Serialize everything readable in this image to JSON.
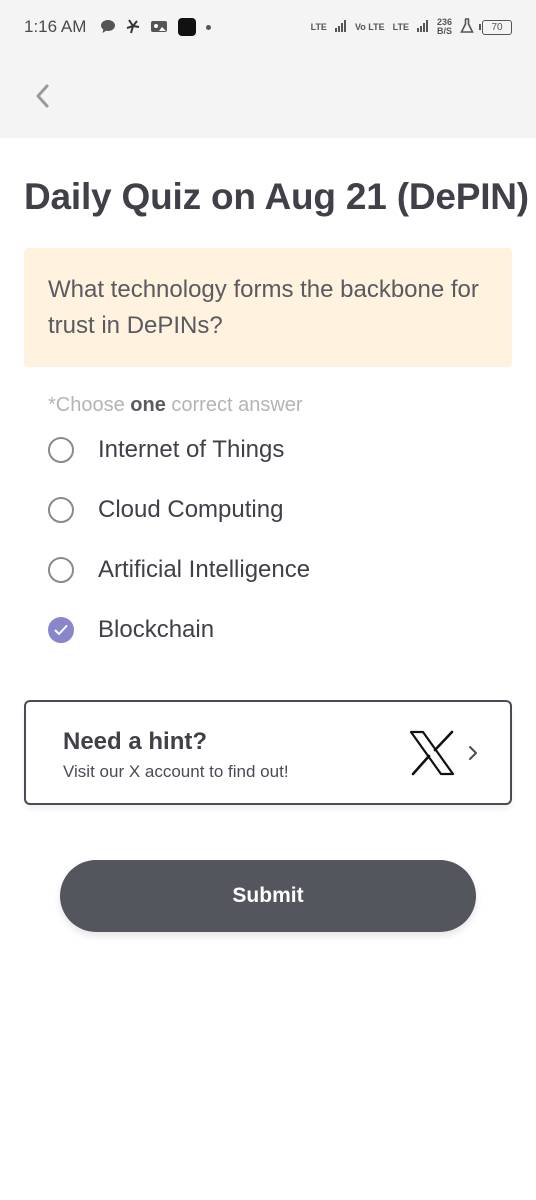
{
  "status_bar": {
    "time": "1:16 AM",
    "left_icons": [
      "chat-bubble-icon",
      "pinwheel-icon",
      "photo-icon",
      "app-square-icon",
      "dot-icon"
    ],
    "network_1": "LTE",
    "network_2": "Vo LTE",
    "network_3": "LTE",
    "speed_value": "236",
    "speed_unit": "B/S",
    "battery": "70"
  },
  "nav": {
    "back_icon": "chevron-left-icon"
  },
  "quiz": {
    "title": "Daily Quiz on Aug 21 (DePIN)",
    "question": "What technology forms the backbone for trust in DePINs?",
    "instruction_prefix": "*Choose ",
    "instruction_emphasis": "one",
    "instruction_suffix": " correct answer",
    "options": [
      {
        "label": "Internet of Things",
        "selected": false
      },
      {
        "label": "Cloud Computing",
        "selected": false
      },
      {
        "label": "Artificial Intelligence",
        "selected": false
      },
      {
        "label": "Blockchain",
        "selected": true
      }
    ]
  },
  "hint": {
    "title": "Need a hint?",
    "subtitle": "Visit our X account to find out!",
    "icon": "x-logo-icon"
  },
  "submit": {
    "label": "Submit"
  },
  "colors": {
    "accent": "#8a86cc",
    "question_bg": "#fff2df",
    "button_bg": "#54565e",
    "text_primary": "#3f4048"
  }
}
